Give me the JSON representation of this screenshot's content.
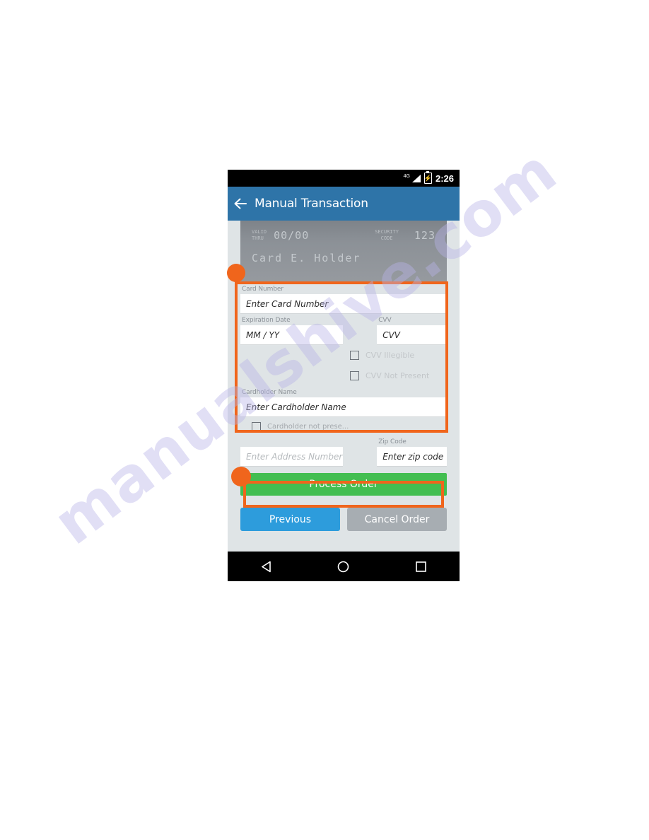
{
  "watermark": {
    "text": "manualshive.com",
    "color": "#b9b4e8"
  },
  "colors": {
    "app_bar_blue": "#2e74a8",
    "process_green": "#43be51",
    "previous_blue": "#2d9cdc",
    "cancel_gray": "#a7adb2",
    "annotation_orange": "#f0651c",
    "form_background": "#dfe4e6"
  },
  "status_bar": {
    "network": "4G",
    "signal_icon": "signal-bars-icon",
    "battery_icon": "battery-charging-icon",
    "time": "2:26"
  },
  "app_bar": {
    "back_icon": "back-arrow-icon",
    "title": "Manual Transaction"
  },
  "card_preview": {
    "valid_thru_line1": "VALID",
    "valid_thru_line2": "THRU",
    "valid_thru_value": "00/00",
    "security_code_line1": "SECURITY",
    "security_code_line2": "CODE",
    "security_code_value": "123",
    "holder_name": "Card E. Holder"
  },
  "form": {
    "card_number": {
      "label": "Card Number",
      "placeholder": "Enter Card Number",
      "value": ""
    },
    "expiration": {
      "label": "Expiration Date",
      "placeholder": "MM / YY",
      "value": ""
    },
    "cvv": {
      "label": "CVV",
      "placeholder": "CVV",
      "value": ""
    },
    "cvv_illegible": {
      "label": "CVV Illegible",
      "checked": false
    },
    "cvv_not_present": {
      "label": "CVV Not Present",
      "checked": false
    },
    "cardholder_name": {
      "label": "Cardholder Name",
      "placeholder": "Enter Cardholder Name",
      "value": ""
    },
    "cardholder_not_present": {
      "label": "Cardholder not prese...",
      "checked": false
    },
    "address_number": {
      "label": "",
      "placeholder": "Enter Address Number",
      "value": ""
    },
    "zip_code": {
      "label": "Zip Code",
      "placeholder": "Enter zip code",
      "value": ""
    }
  },
  "buttons": {
    "process_order": "Process Order",
    "previous": "Previous",
    "cancel_order": "Cancel Order"
  },
  "nav_bar": {
    "back": "nav-back-triangle-icon",
    "home": "nav-home-circle-icon",
    "recents": "nav-recents-square-icon"
  }
}
